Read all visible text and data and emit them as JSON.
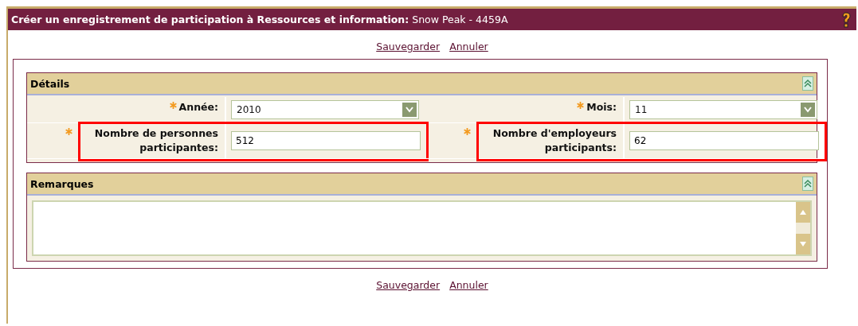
{
  "window": {
    "title": "Créer un enregistrement de participation à Ressources et information:",
    "subtitle": "Snow Peak - 4459A"
  },
  "top_actions": [
    "Sauvegarder",
    "Annuler"
  ],
  "details": {
    "title": "Détails",
    "expanded": true,
    "fields": [
      {
        "kind": "select",
        "label": "Année:",
        "value": "2010",
        "required": true,
        "highlighted": false
      },
      {
        "kind": "select",
        "label": "Mois:",
        "value": "11",
        "required": true,
        "highlighted": false
      },
      {
        "kind": "text",
        "label": "Nombre de personnes participantes:",
        "value": "512",
        "required": true,
        "highlighted": true
      },
      {
        "kind": "text",
        "label": "Nombre d'employeurs participants:",
        "value": "62",
        "required": true,
        "highlighted": true
      }
    ]
  },
  "remarks": {
    "title": "Remarques",
    "expanded": true
  },
  "bottom_actions": [
    "Sauvegarder",
    "Annuler"
  ]
}
